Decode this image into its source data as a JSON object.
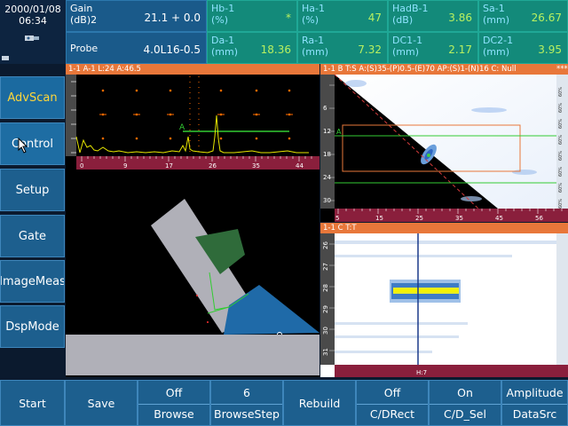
{
  "header": {
    "date": "2000/01/08",
    "time": "06:34",
    "params": [
      {
        "label": "Gain\n(dB)2",
        "value": "21.1 + 0.0"
      },
      {
        "label": "Probe",
        "value": "4.0L16-0.5"
      }
    ],
    "measurements": [
      {
        "label": "Hb-1\n(%)",
        "value": "*"
      },
      {
        "label": "Ha-1\n(%)",
        "value": "47"
      },
      {
        "label": "HadB-1\n(dB)",
        "value": "3.86"
      },
      {
        "label": "Sa-1\n(mm)",
        "value": "26.67"
      },
      {
        "label": "Da-1\n(mm)",
        "value": "18.36"
      },
      {
        "label": "Ra-1\n(mm)",
        "value": "7.32"
      },
      {
        "label": "DC1-1\n(mm)",
        "value": "2.17"
      },
      {
        "label": "DC2-1\n(mm)",
        "value": "3.95"
      }
    ]
  },
  "views": {
    "ascan_title": "1-1 A-1  L:24  A:46.5",
    "sscan_title": "1-1  B  T:S  A:(S)35-(P)0.5-(E)70  AP:(S)1-(N)16  C: Null",
    "sscan_corner": "***",
    "cscan_title": "1-1  C  T:T",
    "ascan_ticks": [
      "0",
      "9",
      "17",
      "26",
      "35",
      "44"
    ],
    "sscan_ticks": [
      "5",
      "15",
      "25",
      "35",
      "45",
      "56"
    ],
    "sscan_vticks": [
      "6",
      "12",
      "18",
      "24",
      "30"
    ],
    "cscan_vticks": [
      "26",
      "27",
      "28",
      "29",
      "30",
      "31"
    ],
    "cscan_bottom": "H:7",
    "ascan_gate_label": "A",
    "sscan_gate_label": "A",
    "sscan_right_labels": [
      "%09",
      "%09",
      "%09",
      "%09",
      "%09",
      "%09",
      "%09",
      "%09"
    ]
  },
  "menu": {
    "items": [
      "AdvScan",
      "Control",
      "Setup",
      "Gate",
      "ImageMeas",
      "DspMode"
    ]
  },
  "bottom": {
    "start": "Start",
    "save": "Save",
    "browse_value": "Off",
    "browse": "Browse",
    "browsestep_value": "6",
    "browsestep": "BrowseStep",
    "rebuild": "Rebuild",
    "cdrect_value": "Off",
    "cdrect": "C/DRect",
    "cdsel_value": "On",
    "cdsel": "C/D_Sel",
    "datasrc_value": "Amplitude",
    "datasrc": "DataSrc"
  },
  "colors": {
    "panel_bg": "#1a5a8a",
    "meas_bg": "#138a7a",
    "meas_value": "#b8f060",
    "accent_orange": "#e8773a",
    "active_menu": "#ffd63a"
  }
}
